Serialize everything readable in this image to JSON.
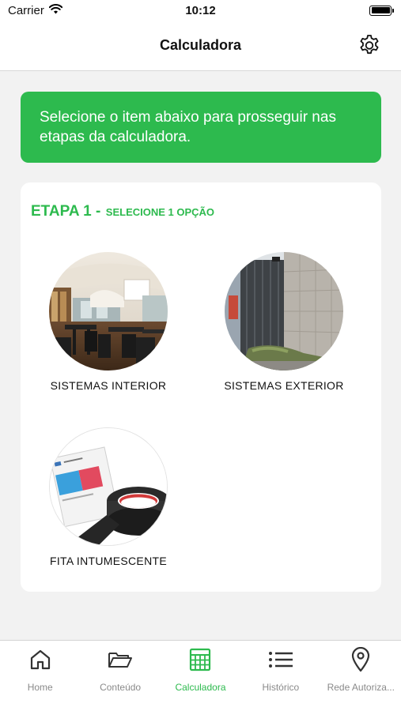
{
  "status_bar": {
    "carrier": "Carrier",
    "time": "10:12"
  },
  "header": {
    "title": "Calculadora",
    "settings_icon": "gear-icon"
  },
  "banner": {
    "text": "Selecione o item abaixo para prosseguir nas etapas da calculadora."
  },
  "step": {
    "title": "ETAPA 1 -",
    "subtitle": "SELECIONE 1 OPÇÃO",
    "options": [
      {
        "label": "SISTEMAS INTERIOR",
        "image": "restaurant-interior-photo"
      },
      {
        "label": "SISTEMAS EXTERIOR",
        "image": "building-facade-photo"
      },
      {
        "label": "FITA INTUMESCENTE",
        "image": "intumescent-tape-photo"
      }
    ]
  },
  "tab_bar": {
    "active_index": 2,
    "tabs": [
      {
        "label": "Home",
        "icon": "home-icon"
      },
      {
        "label": "Conteúdo",
        "icon": "folder-icon"
      },
      {
        "label": "Calculadora",
        "icon": "calculator-icon"
      },
      {
        "label": "Histórico",
        "icon": "list-icon"
      },
      {
        "label": "Rede Autoriza...",
        "icon": "location-pin-icon"
      }
    ]
  },
  "colors": {
    "accent": "#2dba4e",
    "background": "#f2f2f2",
    "tab_inactive": "#8a8a8a"
  }
}
